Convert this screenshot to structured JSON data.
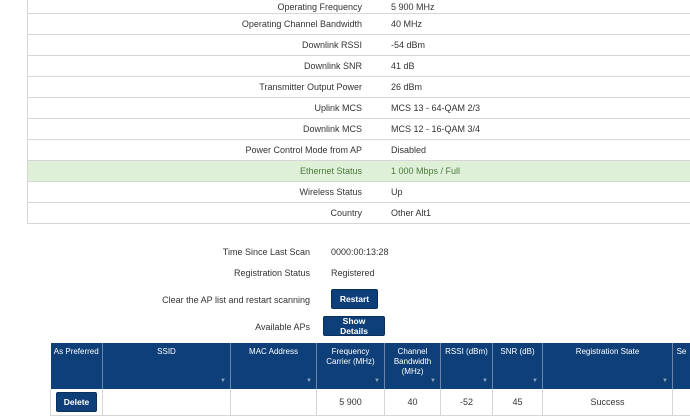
{
  "status_rows": [
    {
      "label": "Operating Frequency",
      "value": "5 900 MHz"
    },
    {
      "label": "Operating Channel Bandwidth",
      "value": "40 MHz"
    },
    {
      "label": "Downlink RSSI",
      "value": "-54 dBm"
    },
    {
      "label": "Downlink SNR",
      "value": "41 dB"
    },
    {
      "label": "Transmitter Output Power",
      "value": "26 dBm"
    },
    {
      "label": "Uplink MCS",
      "value": "MCS 13 - 64-QAM 2/3"
    },
    {
      "label": "Downlink MCS",
      "value": "MCS 12 - 16-QAM 3/4"
    },
    {
      "label": "Power Control Mode from AP",
      "value": "Disabled"
    },
    {
      "label": "Ethernet Status",
      "value": "1 000 Mbps / Full"
    },
    {
      "label": "Wireless Status",
      "value": "Up"
    },
    {
      "label": "Country",
      "value": "Other Alt1"
    }
  ],
  "scan": {
    "time_label": "Time Since Last Scan",
    "time_value": "0000:00:13:28",
    "registration_label": "Registration Status",
    "registration_value": "Registered",
    "restart_label": "Clear the AP list and restart scanning",
    "restart_button": "Restart",
    "available_label": "Available APs",
    "show_details_button": "Show Details"
  },
  "ap_table": {
    "headers": [
      "As Preferred",
      "SSID",
      "MAC Address",
      "Frequency Carrier (MHz)",
      "Channel Bandwidth (MHz)",
      "RSSI (dBm)",
      "SNR (dB)",
      "Registration State",
      "Se"
    ],
    "rows": [
      {
        "action": "Delete",
        "ssid": "",
        "mac": "",
        "frequency": "5 900",
        "bandwidth": "40",
        "rssi": "-52",
        "snr": "45",
        "state": "Success",
        "extra": ""
      }
    ]
  },
  "colors": {
    "header_blue": "#0e3f78",
    "highlight_green": "#dff0d8"
  }
}
